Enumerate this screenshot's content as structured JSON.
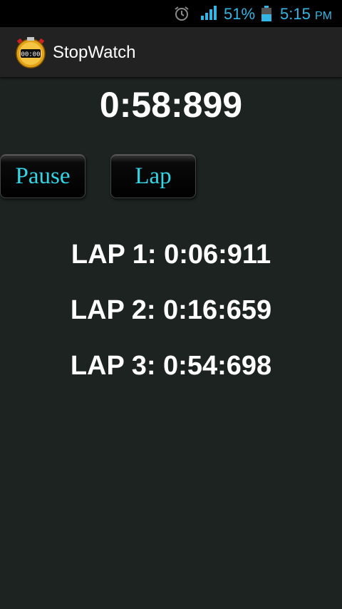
{
  "status_bar": {
    "battery_percent": "51%",
    "time": "5:15",
    "ampm": "PM",
    "accent_color": "#33b5e5",
    "icons": [
      "alarm-icon",
      "signal-icon",
      "battery-icon"
    ]
  },
  "app": {
    "title": "StopWatch",
    "icon": "stopwatch-icon",
    "icon_display": "00:00"
  },
  "timer": {
    "value": "0:58:899"
  },
  "buttons": {
    "pause_label": "Pause",
    "lap_label": "Lap",
    "label_color": "#33d6e6"
  },
  "laps": [
    {
      "label": "LAP 1: 0:06:911"
    },
    {
      "label": "LAP 2: 0:16:659"
    },
    {
      "label": "LAP 3: 0:54:698"
    }
  ]
}
